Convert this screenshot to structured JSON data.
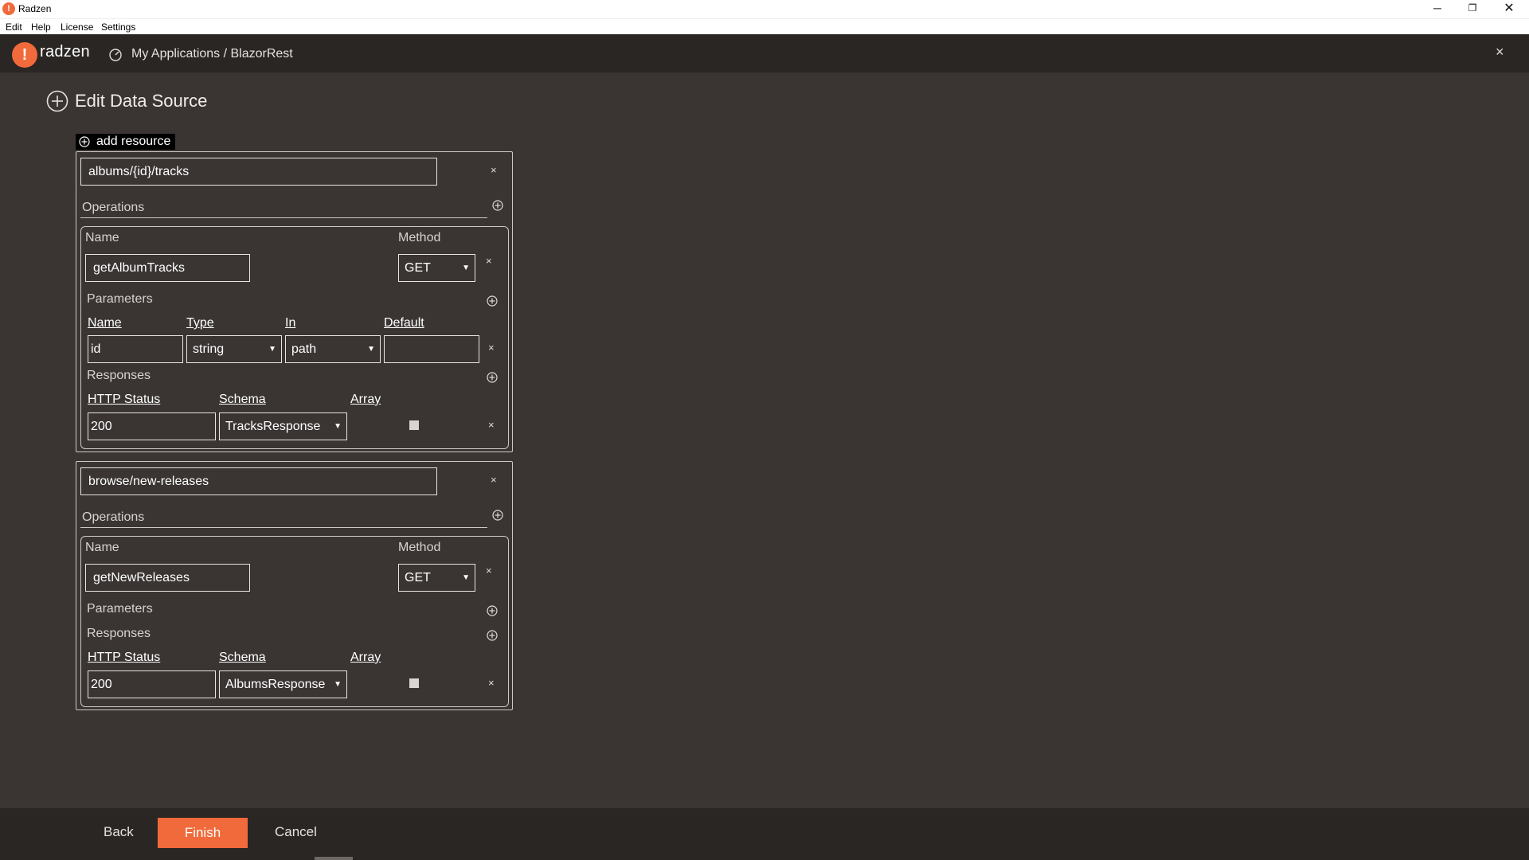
{
  "window": {
    "title": "Radzen",
    "min": "─",
    "max": "❐",
    "close": "✕"
  },
  "menu": [
    "Edit",
    "Help",
    "License",
    "Settings"
  ],
  "header": {
    "logo_mark": "!",
    "logo_text": "radzen",
    "breadcrumb": "My Applications / BlazorRest",
    "close": "×"
  },
  "page": {
    "title": "Edit Data Source",
    "add_resource": "add resource"
  },
  "labels": {
    "operations": "Operations",
    "name": "Name",
    "method": "Method",
    "parameters": "Parameters",
    "responses": "Responses",
    "param_name": "Name",
    "param_type": "Type",
    "param_in": "In",
    "param_default": "Default",
    "http_status": "HTTP Status",
    "schema": "Schema",
    "array": "Array",
    "remove": "×"
  },
  "resources": [
    {
      "path": "albums/{id}/tracks",
      "operation": {
        "name": "getAlbumTracks",
        "method": "GET",
        "parameters": [
          {
            "name": "id",
            "type": "string",
            "in": "path",
            "default": ""
          }
        ],
        "responses": [
          {
            "status": "200",
            "schema": "TracksResponse",
            "array": false
          }
        ]
      }
    },
    {
      "path": "browse/new-releases",
      "operation": {
        "name": "getNewReleases",
        "method": "GET",
        "parameters": [],
        "responses": [
          {
            "status": "200",
            "schema": "AlbumsResponse",
            "array": false
          }
        ]
      }
    }
  ],
  "footer": {
    "back": "Back",
    "finish": "Finish",
    "cancel": "Cancel"
  },
  "colors": {
    "accent": "#f06a3b",
    "background": "#3a3533",
    "header": "#2a2624"
  }
}
